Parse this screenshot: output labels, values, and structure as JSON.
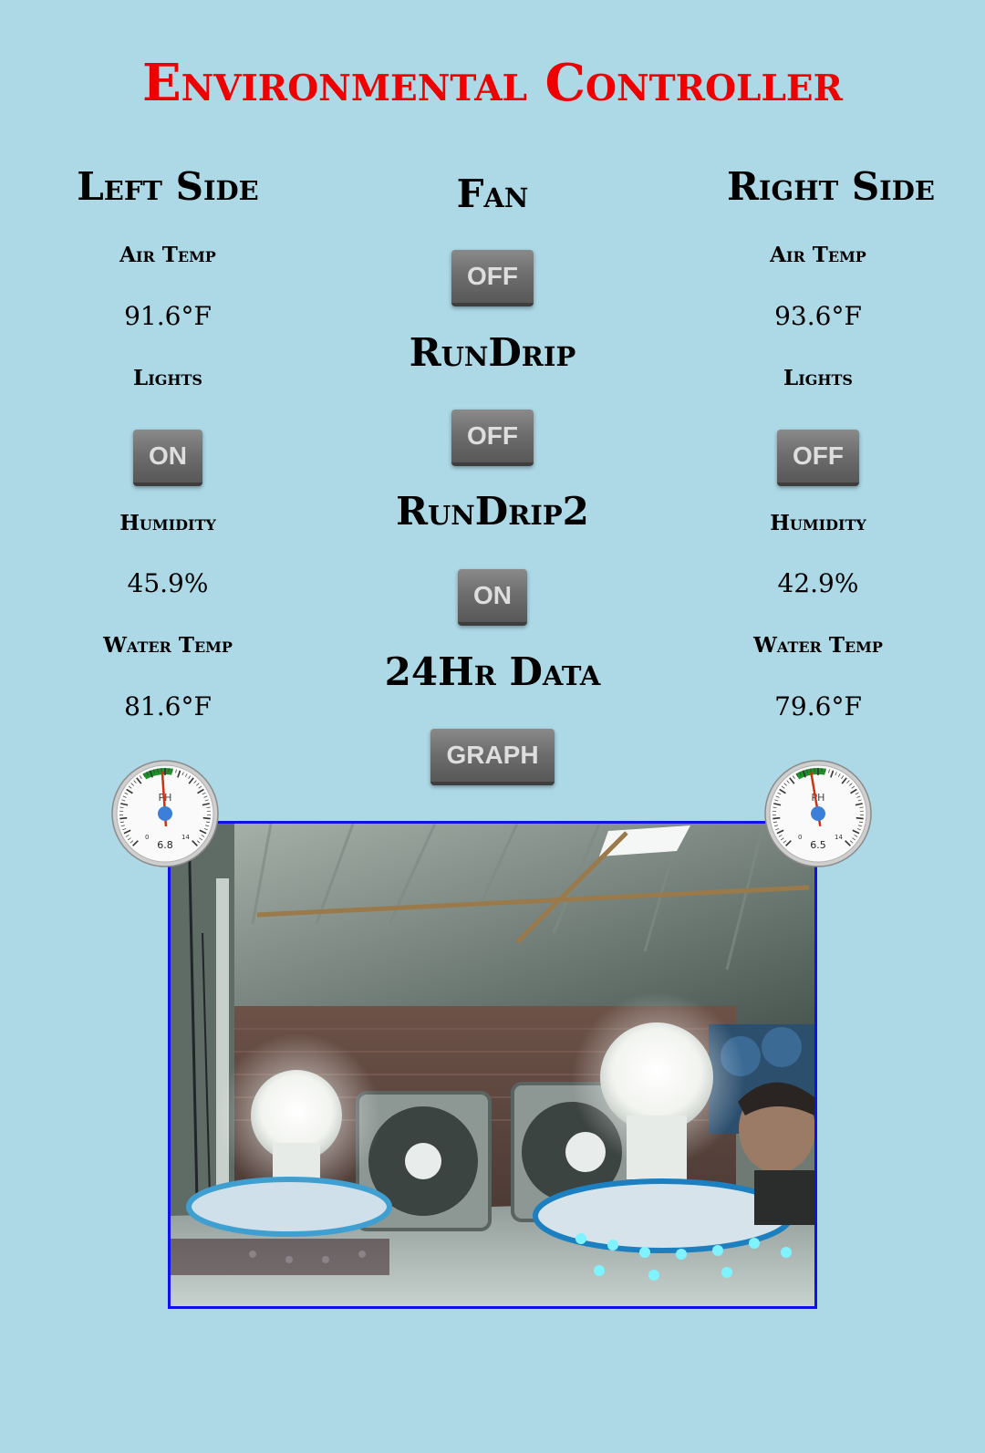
{
  "title": "Environmental Controller",
  "left": {
    "heading": "Left Side",
    "air_temp_label": "Air Temp",
    "air_temp_value": "91.6°F",
    "lights_label": "Lights",
    "lights_button": "ON",
    "humidity_label": "Humidity",
    "humidity_value": "45.9%",
    "water_temp_label": "Water Temp",
    "water_temp_value": "81.6°F",
    "gauge": {
      "label": "PH",
      "value_text": "6.8",
      "value": 6.8,
      "min": 0,
      "max": 14,
      "min_label": "0",
      "max_label": "14",
      "ok_band": [
        5.5,
        7.5
      ]
    }
  },
  "middle": {
    "fan_heading": "Fan",
    "fan_button": "OFF",
    "rundrip_heading": "RunDrip",
    "rundrip_button": "OFF",
    "rundrip2_heading": "RunDrip2",
    "rundrip2_button": "ON",
    "data_heading": "24Hr Data",
    "graph_button": "GRAPH"
  },
  "right": {
    "heading": "Right Side",
    "air_temp_label": "Air Temp",
    "air_temp_value": "93.6°F",
    "lights_label": "Lights",
    "lights_button": "OFF",
    "humidity_label": "Humidity",
    "humidity_value": "42.9%",
    "water_temp_label": "Water Temp",
    "water_temp_value": "79.6°F",
    "gauge": {
      "label": "PH",
      "value_text": "6.5",
      "value": 6.5,
      "min": 0,
      "max": 14,
      "min_label": "0",
      "max_label": "14",
      "ok_band": [
        5.5,
        7.5
      ]
    }
  },
  "colors": {
    "background": "#add8e6",
    "title": "#ee0000",
    "camera_border": "#1010ee",
    "gauge_band": "#1f8f2a",
    "gauge_needle": "#cc3311",
    "gauge_hub": "#3b7fd9"
  },
  "camera": {
    "description_icon": "camera-feed-image"
  }
}
